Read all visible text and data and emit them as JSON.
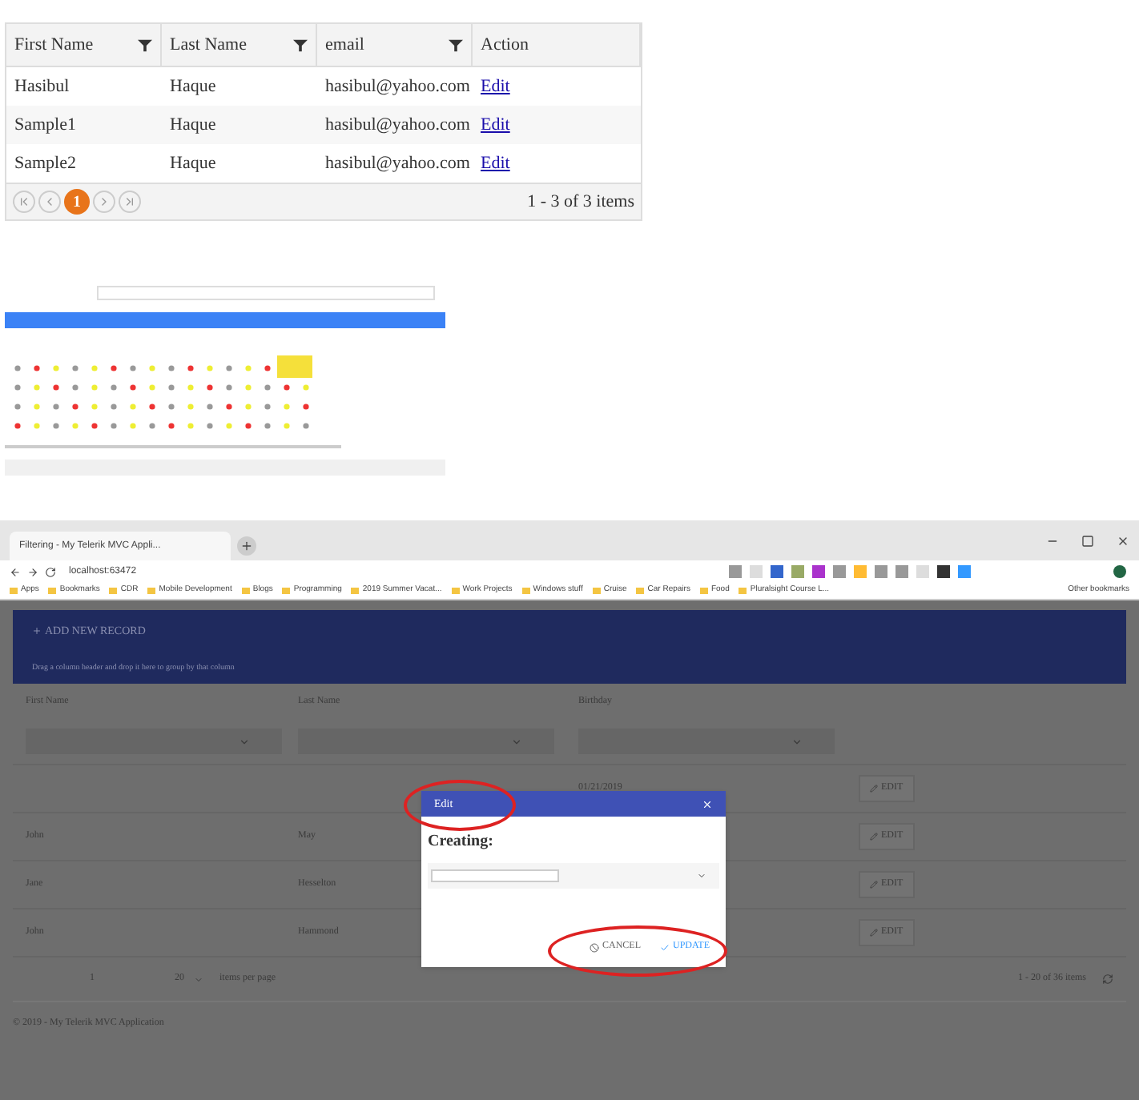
{
  "grid": {
    "columns": [
      {
        "label": "First Name",
        "filter": true
      },
      {
        "label": "Last Name",
        "filter": true
      },
      {
        "label": "email",
        "filter": true
      },
      {
        "label": "Action",
        "filter": false
      }
    ],
    "rows": [
      {
        "first_name": "Hasibul",
        "last_name": "Haque",
        "email": "hasibul@yahoo.com",
        "action": "Edit"
      },
      {
        "first_name": "Sample1",
        "last_name": "Haque",
        "email": "hasibul@yahoo.com",
        "action": "Edit"
      },
      {
        "first_name": "Sample2",
        "last_name": "Haque",
        "email": "hasibul@yahoo.com",
        "action": "Edit"
      }
    ],
    "pager": {
      "pages": [
        {
          "label": "1",
          "selected": true
        }
      ],
      "summary": "1 - 3 of 3 items"
    }
  },
  "browser": {
    "tab_title": "Filtering - My Telerik MVC Appli...",
    "url": "localhost:63472",
    "bookmarks": [
      "Apps",
      "Bookmarks",
      "CDR",
      "Mobile Development",
      "Blogs",
      "Programming",
      "2019 Summer Vacat...",
      "Work Projects",
      "Windows stuff",
      "Cruise",
      "Car Repairs",
      "Food",
      "Pluralsight Course L..."
    ],
    "other_bookmarks": "Other bookmarks"
  },
  "app": {
    "add_button": "ADD NEW RECORD",
    "group_hint": "Drag a column header and drop it here to group by that column",
    "columns": [
      "First Name",
      "Last Name",
      "Birthday"
    ],
    "rows": [
      {
        "birthday": "01/21/2019",
        "action": "EDIT"
      },
      {
        "first_name": "John",
        "last_name": "May",
        "action": "EDIT"
      },
      {
        "first_name": "Jane",
        "last_name": "Hesselton",
        "action": "EDIT"
      },
      {
        "first_name": "John",
        "last_name": "Hammond",
        "action": "EDIT"
      }
    ],
    "pager": {
      "page": "1",
      "page_size": "20",
      "page_size_label": "items per page",
      "summary": "1 - 20 of 36 items"
    },
    "footer": "© 2019 - My Telerik MVC Application"
  },
  "dialog": {
    "title": "Edit",
    "heading": "Creating:",
    "cancel": "CANCEL",
    "update": "UPDATE"
  }
}
